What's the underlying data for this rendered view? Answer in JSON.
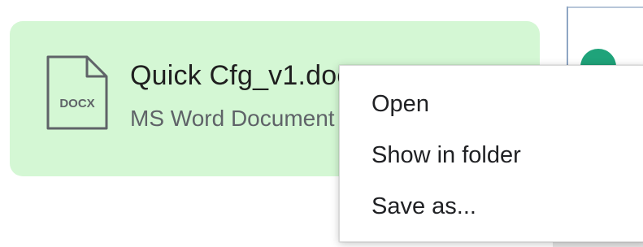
{
  "download": {
    "file_name": "Quick Cfg_v1.docx",
    "file_type": "MS Word Document",
    "icon_label": "DOCX",
    "card_color": "#d4f7d4",
    "icon": "docx-file-icon"
  },
  "context_menu": {
    "items": [
      {
        "label": "Open"
      },
      {
        "label": "Show in folder"
      },
      {
        "label": "Save as..."
      }
    ]
  },
  "colors": {
    "menu_text": "#202124",
    "secondary_text": "#5f6368",
    "accent_dot": "#1fa37a"
  }
}
